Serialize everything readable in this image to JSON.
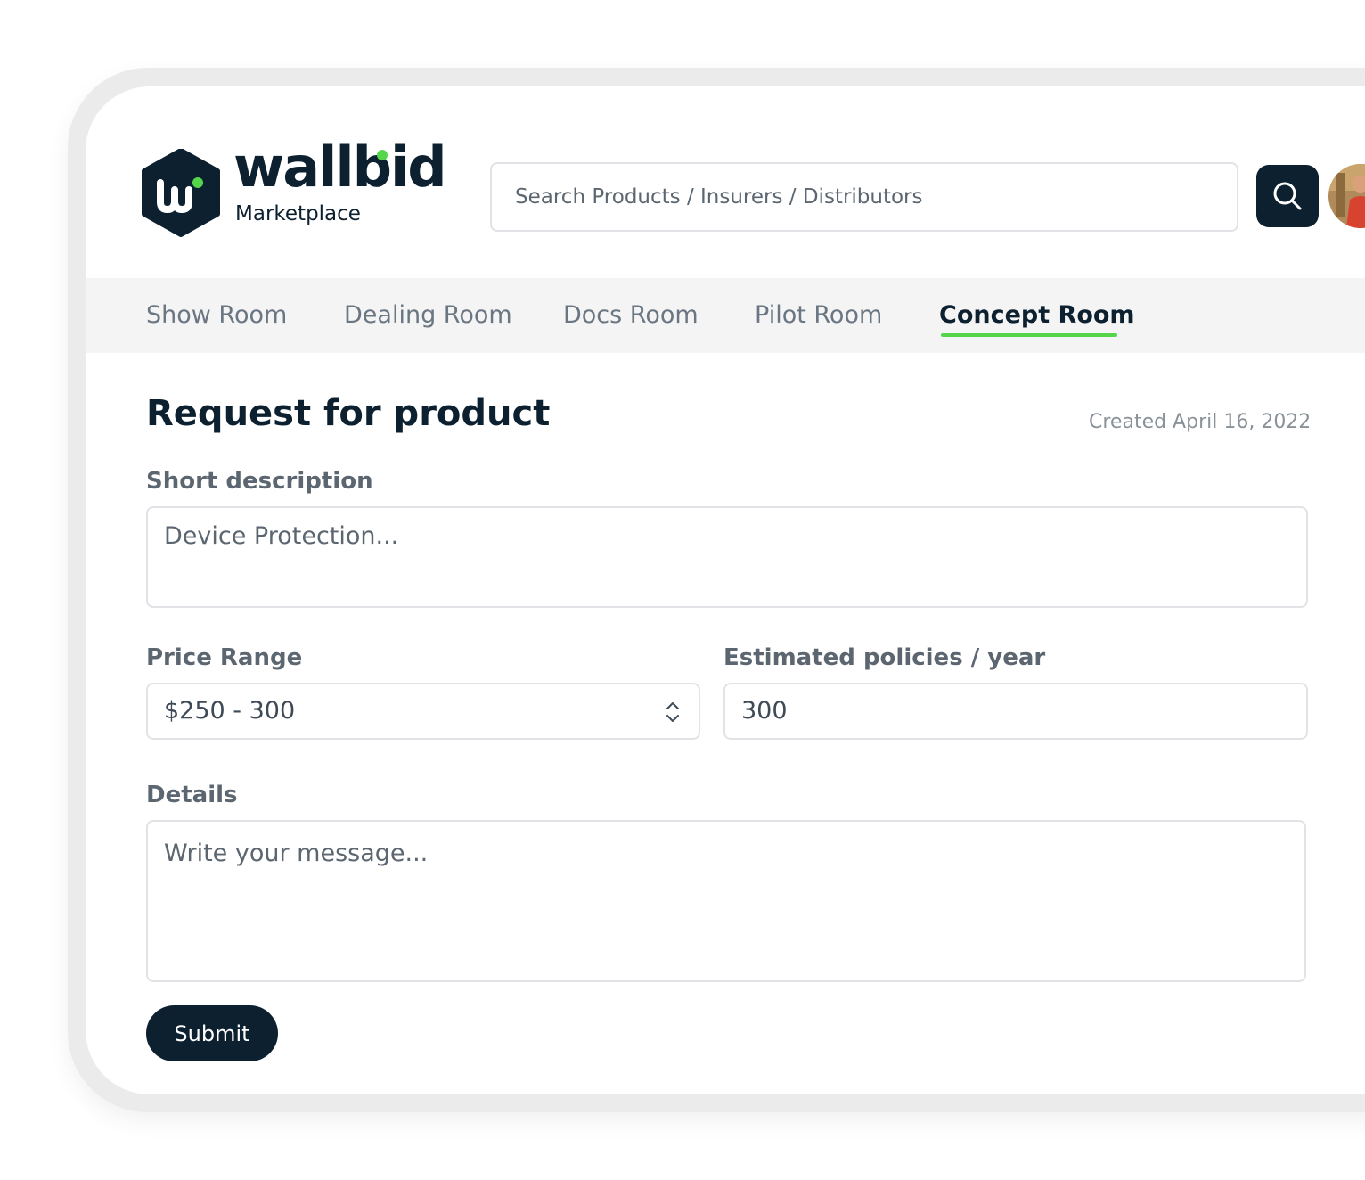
{
  "brand": {
    "name": "wallbid",
    "subtitle": "Marketplace",
    "accent_color": "#55d54a",
    "dark_color": "#0c2030"
  },
  "search": {
    "placeholder": "Search Products / Insurers / Distributors",
    "button_icon": "search-icon"
  },
  "user": {
    "avatar_icon": "user-avatar"
  },
  "nav": {
    "items": [
      {
        "label": "Show Room",
        "active": false
      },
      {
        "label": "Dealing Room",
        "active": false
      },
      {
        "label": "Docs Room",
        "active": false
      },
      {
        "label": "Pilot Room",
        "active": false
      },
      {
        "label": "Concept Room",
        "active": true
      }
    ]
  },
  "form": {
    "title": "Request for product",
    "created": "Created April 16, 2022",
    "short_description": {
      "label": "Short description",
      "placeholder": "Device Protection..."
    },
    "price_range": {
      "label": "Price Range",
      "value": "$250 - 300",
      "icon": "chevron-up-down-icon"
    },
    "estimated_policies": {
      "label": "Estimated policies / year",
      "value": "300"
    },
    "details": {
      "label": "Details",
      "placeholder": "Write your message..."
    },
    "submit_label": "Submit"
  }
}
